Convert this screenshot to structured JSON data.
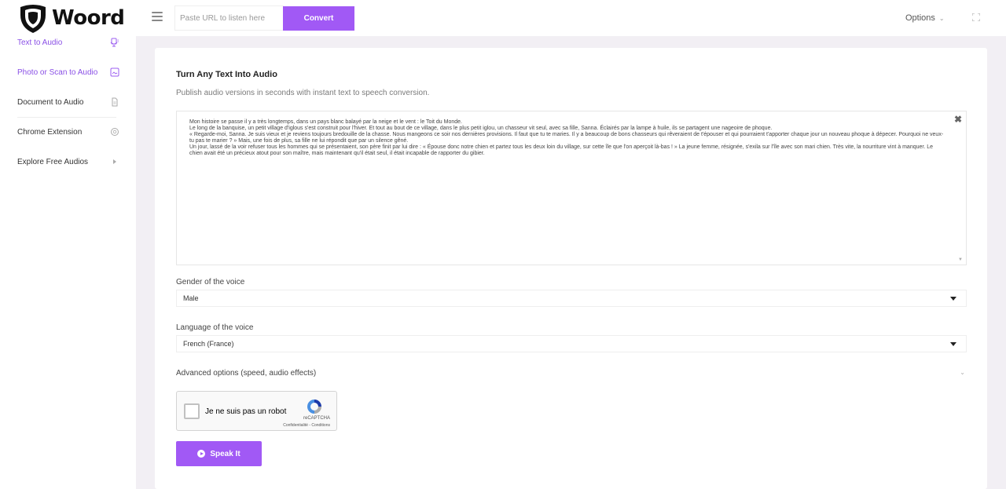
{
  "brand": {
    "name": "Woord"
  },
  "header": {
    "url_placeholder": "Paste URL to listen here",
    "convert_label": "Convert",
    "options_label": "Options"
  },
  "sidebar": {
    "items": [
      {
        "label": "Text to Audio",
        "icon": "mic-icon",
        "active": true
      },
      {
        "label": "Photo or Scan to Audio",
        "icon": "image-icon",
        "active": false
      },
      {
        "label": "Document to Audio",
        "icon": "document-icon",
        "active": false
      },
      {
        "label": "Chrome Extension",
        "icon": "chrome-icon",
        "active": false
      },
      {
        "label": "Explore Free Audios",
        "icon": "play-icon",
        "active": false
      }
    ]
  },
  "main": {
    "title": "Turn Any Text Into Audio",
    "subtitle": "Publish audio versions in seconds with instant text to speech conversion.",
    "text": "Mon histoire se passe il y a très longtemps, dans un pays blanc balayé par la neige et le vent : le Toit du Monde.\nLe long de la banquise, un petit village d'iglous s'est construit pour l'hiver. Et tout au bout de ce village, dans le plus petit iglou, un chasseur vit seul, avec sa fille, Sanna. Éclairés par la lampe à huile, ils se partagent une nageoire de phoque.\n« Regarde-moi, Sanna. Je suis vieux et je reviens toujours bredouille de la chasse. Nous mangeons ce soir nos dernières provisions. Il faut que tu te maries. Il y a beaucoup de bons chasseurs qui rêveraient de t'épouser et qui pourraient t'apporter chaque jour un nouveau phoque à dépecer. Pourquoi ne veux-tu pas te marier ? » Mais, une fois de plus, sa fille ne lui répondit que par un silence gêné.\nUn jour, lassé de la voir refuser tous les hommes qui se présentaient, son père finit par lui dire : « Épouse donc notre chien et partez tous les deux loin du village, sur cette île que l'on aperçoit là-bas ! » La jeune femme, résignée, s'exila sur l'île avec son mari chien. Très vite, la nourriture vint à manquer. Le chien avait été un précieux atout pour son maître, mais maintenant qu'il était seul, il était incapable de rapporter du gibier.",
    "gender_label": "Gender of the voice",
    "gender_value": "Male",
    "language_label": "Language of the voice",
    "language_value": "French (France)",
    "advanced_label": "Advanced options (speed, audio effects)",
    "speak_label": "Speak It"
  },
  "recaptcha": {
    "label": "Je ne suis pas un robot",
    "brand": "reCAPTCHA",
    "terms": "Confidentialité - Conditions"
  },
  "colors": {
    "accent": "#a159f5",
    "active_text": "#8a50e6",
    "page_bg": "#f2eff4"
  }
}
